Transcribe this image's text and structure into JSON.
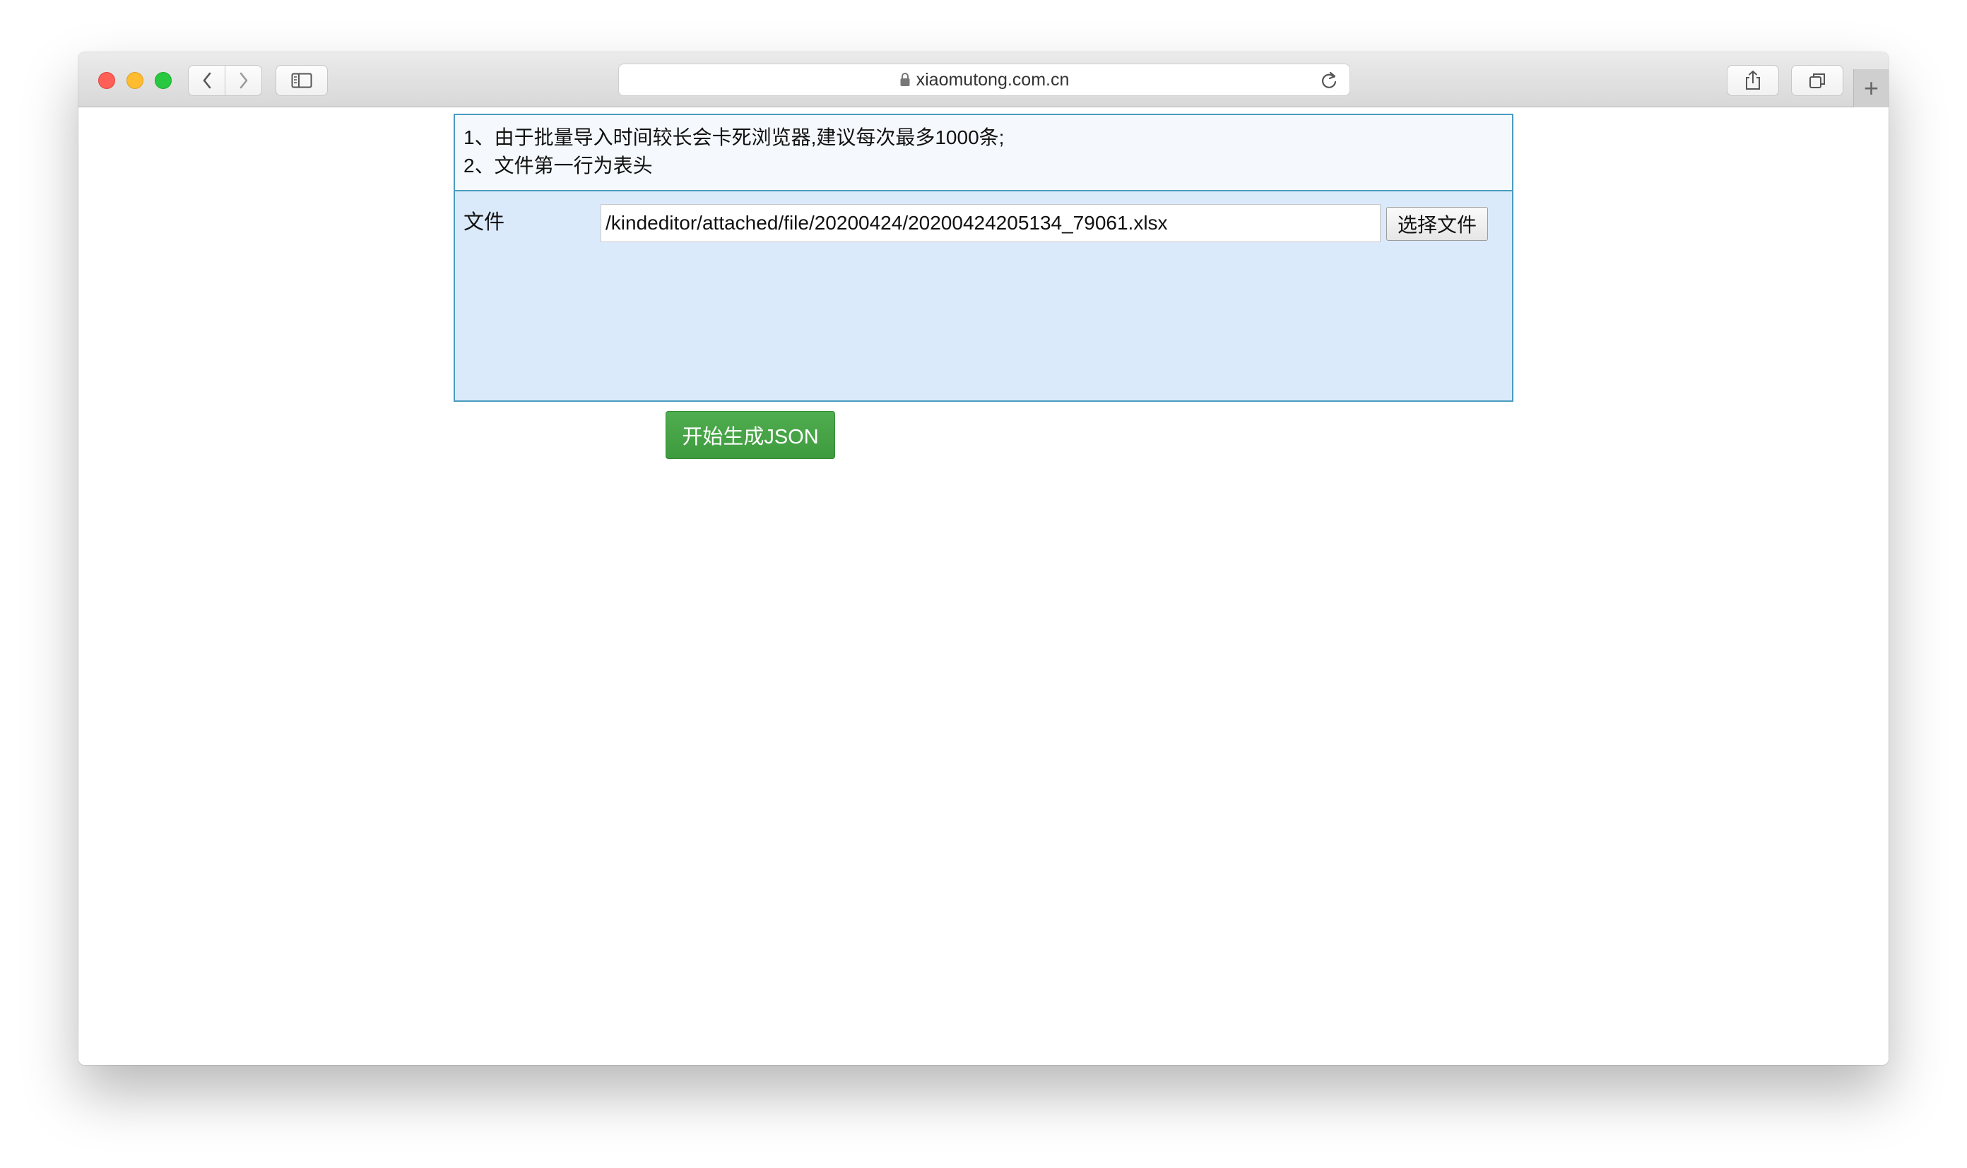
{
  "browser": {
    "url": "xiaomutong.com.cn",
    "new_tab_label": "+"
  },
  "notes": {
    "line1": "1、由于批量导入时间较长会卡死浏览器,建议每次最多1000条;",
    "line2": "2、文件第一行为表头"
  },
  "form": {
    "file_label": "文件",
    "file_path": "/kindeditor/attached/file/20200424/20200424205134_79061.xlsx",
    "choose_button": "选择文件"
  },
  "actions": {
    "generate_button": "开始生成JSON"
  },
  "colors": {
    "panel_border": "#4a9bbf",
    "panel_bg": "#dbeafb",
    "button_green": "#45a345"
  }
}
